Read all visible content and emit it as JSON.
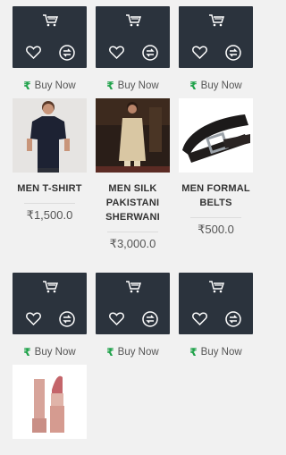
{
  "action_rows": [
    [
      {
        "buy_label": "Buy Now"
      },
      {
        "buy_label": "Buy Now"
      },
      {
        "buy_label": "Buy Now"
      }
    ],
    [
      {
        "buy_label": "Buy Now"
      },
      {
        "buy_label": "Buy Now"
      },
      {
        "buy_label": "Buy Now"
      }
    ]
  ],
  "products": [
    {
      "name": "MEN T-SHIRT",
      "price": "₹1,500.0"
    },
    {
      "name": "MEN SILK PAKISTANI SHERWANI",
      "price": "₹3,000.0"
    },
    {
      "name": "MEN FORMAL BELTS",
      "price": "₹500.0"
    }
  ],
  "icons": {
    "card_bg": "#2b333d",
    "rupee_color": "#1fa24a",
    "rupee_glyph": "₹",
    "cart": "cart-icon",
    "wishlist": "heart-icon",
    "compare": "compare-icon"
  }
}
